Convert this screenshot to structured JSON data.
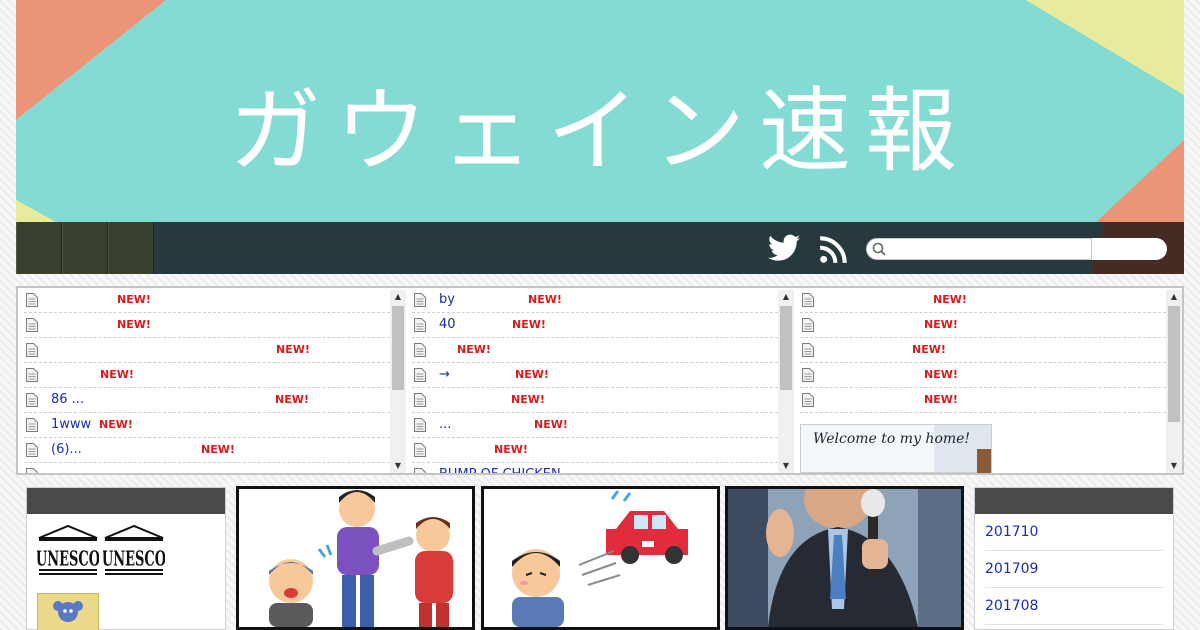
{
  "site": {
    "title": "ガウェイン速報",
    "colors": {
      "banner_teal": "#83dbd4",
      "banner_yellow": "#e6ec9c",
      "banner_salmon": "#ec9477",
      "navbar": "#26393d",
      "link": "#1a2cb0",
      "new_badge": "#d81b1b"
    }
  },
  "nav": {
    "twitter_icon": "twitter-icon",
    "rss_icon": "rss-icon",
    "search": {
      "placeholder": "",
      "value": "",
      "button_label": ""
    }
  },
  "rss_columns": [
    {
      "items": [
        {
          "title": "",
          "new": "NEW!"
        },
        {
          "title": "",
          "new": "NEW!"
        },
        {
          "title": "",
          "new": "NEW!"
        },
        {
          "title": "",
          "new": "NEW!"
        },
        {
          "title": "86 ...",
          "new": "NEW!"
        },
        {
          "title": "1www",
          "new": "NEW!"
        },
        {
          "title": "(6)...",
          "new": "NEW!"
        },
        {
          "title": "",
          "new": ""
        }
      ]
    },
    {
      "items": [
        {
          "title": "by",
          "new": "NEW!"
        },
        {
          "title": "40",
          "new": "NEW!"
        },
        {
          "title": "",
          "new": "NEW!"
        },
        {
          "title": "→",
          "new": "NEW!"
        },
        {
          "title": "",
          "new": "NEW!"
        },
        {
          "title": "...",
          "new": "NEW!"
        },
        {
          "title": "",
          "new": "NEW!"
        },
        {
          "title": "BUMP OF CHICKEN",
          "new": ""
        }
      ]
    },
    {
      "items": [
        {
          "title": "",
          "new": "NEW!"
        },
        {
          "title": "",
          "new": "NEW!"
        },
        {
          "title": "",
          "new": "NEW!"
        },
        {
          "title": "",
          "new": "NEW!"
        },
        {
          "title": "",
          "new": "NEW!"
        }
      ],
      "image_text": "Welcome to my home!"
    }
  ],
  "left_widget": {
    "logos": [
      "UNESCO",
      "UNESCO"
    ]
  },
  "archive": {
    "items": [
      "201710",
      "201709",
      "201708"
    ]
  }
}
